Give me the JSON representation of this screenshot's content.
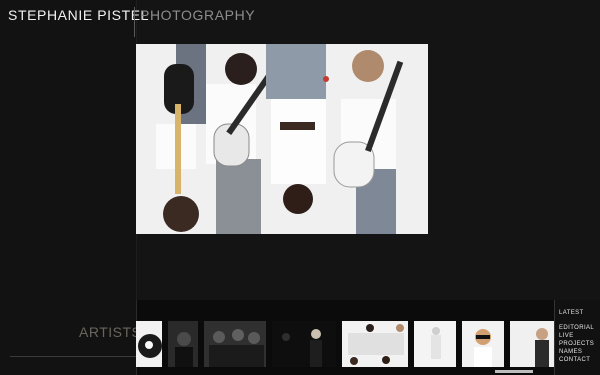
{
  "brand": {
    "name": "STEPHANIE PISTEL",
    "section": "PHOTOGRAPHY"
  },
  "sidebar": {
    "title": "ARTISTS"
  },
  "menu": {
    "items": [
      "LATEST",
      "EDITORIAL",
      "LIVE",
      "PROJECTS",
      "NAMES",
      "CONTACT"
    ]
  },
  "hero": {
    "icon": "band-photo-image"
  },
  "thumbnails": [
    {
      "kind": "portrait-hand"
    },
    {
      "kind": "dark-portrait"
    },
    {
      "kind": "group-dark"
    },
    {
      "kind": "performer-dark"
    },
    {
      "kind": "band-upside-down"
    },
    {
      "kind": "dancer-white"
    },
    {
      "kind": "sunglasses-man"
    },
    {
      "kind": "suit-man"
    }
  ]
}
